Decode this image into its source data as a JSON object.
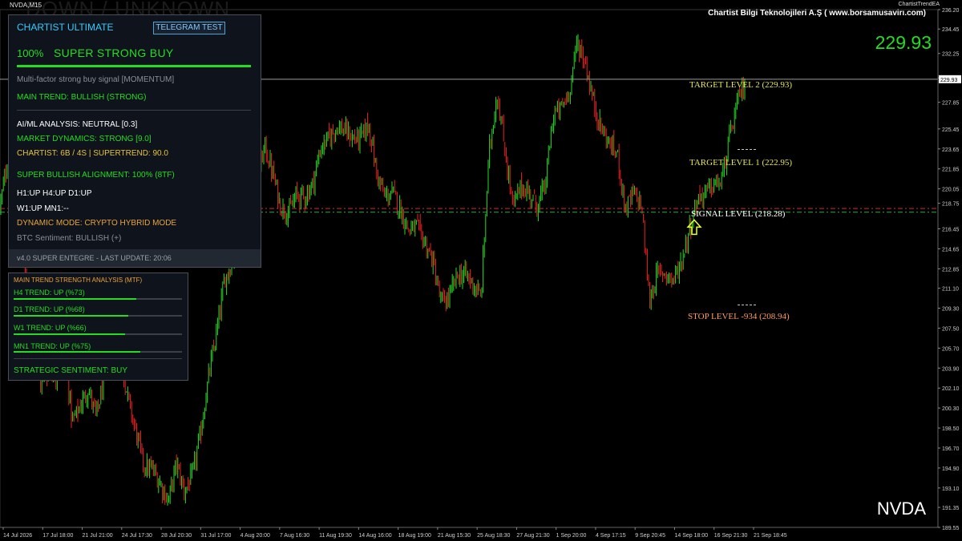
{
  "window": {
    "symbol_title": "NVDA,M15",
    "watermark": "DOWN / UNKNOWN",
    "ea_name": "ChartistTrendEA",
    "brand": "Chartist Bilgi Teknolojileri A.Ş ( www.borsamusavirı.com)",
    "big_price": "229.93",
    "symbol_big": "NVDA",
    "price_tag": "229.93"
  },
  "levels": {
    "target2": "TARGET LEVEL 2 (229.93)",
    "target1": "TARGET LEVEL 1 (222.95)",
    "signal": "SIGNAL LEVEL (218.28)",
    "stop": "STOP LEVEL -934 (208.94)"
  },
  "panel_main": {
    "title": "CHARTIST ULTIMATE",
    "telegram_button": "TELEGRAM TEST",
    "signal_pct": "100%",
    "signal_label": "SUPER STRONG BUY",
    "signal_desc": "Multi-factor strong buy signal [MOMENTUM]",
    "main_trend": "MAIN TREND: BULLISH (STRONG)",
    "ai_ml": "AI/ML ANALYSIS: NEUTRAL [0.3]",
    "market_dynamics": "MARKET DYNAMICS: STRONG [9.0]",
    "chartist": "CHARTIST: 6B / 4S | SUPERTREND: 90.0",
    "alignment": "SUPER BULLISH ALIGNMENT: 100% (8TF)",
    "tf_line1": "H1:UP H4:UP D1:UP",
    "tf_line2": "W1:UP MN1:--",
    "dynamic_mode": "DYNAMIC MODE: CRYPTO HYBRID MODE",
    "btc_sentiment": "BTC Sentiment: BULLISH (+)",
    "footer": "v4.0 SUPER ENTEGRE - LAST UPDATE: 20:06"
  },
  "panel_mtf": {
    "title": "MAIN TREND STRENGTH ANALYSIS (MTF)",
    "rows": [
      {
        "label": "H4 TREND: UP (%73)",
        "strength": 0.73
      },
      {
        "label": "D1 TREND: UP (%68)",
        "strength": 0.68
      },
      {
        "label": "W1 TREND: UP (%66)",
        "strength": 0.66
      },
      {
        "label": "MN1 TREND: UP (%75)",
        "strength": 0.75
      }
    ],
    "sentiment": "STRATEGIC SENTIMENT: BUY"
  },
  "colors": {
    "bull": "#22dd22",
    "bear": "#ee2222",
    "accent": "#33ccff",
    "target": "#e6e656",
    "stop": "#ff9a5a"
  },
  "chart_data": {
    "type": "candlestick",
    "symbol": "NVDA",
    "timeframe": "M15",
    "ylim": [
      189.55,
      236.2
    ],
    "y_ticks": [
      "236.20",
      "234.45",
      "232.25",
      "230.05",
      "229.93",
      "227.85",
      "225.45",
      "223.65",
      "221.85",
      "220.05",
      "218.75",
      "216.45",
      "214.65",
      "212.85",
      "211.10",
      "209.30",
      "207.50",
      "205.70",
      "203.90",
      "202.10",
      "200.30",
      "198.50",
      "196.70",
      "194.90",
      "193.10",
      "191.35",
      "189.55"
    ],
    "x_ticks": [
      "14 Jul 2026",
      "17 Jul 18:00",
      "21 Jul 21:00",
      "24 Jul 17:30",
      "28 Jul 20:30",
      "31 Jul 17:00",
      "4 Aug 20:00",
      "7 Aug 16:30",
      "11 Aug 19:30",
      "14 Aug 16:00",
      "18 Aug 19:00",
      "21 Aug 15:30",
      "25 Aug 18:30",
      "27 Aug 21:30",
      "1 Sep 20:00",
      "4 Sep 17:15",
      "9 Sep 20:45",
      "14 Sep 18:00",
      "16 Sep 21:30",
      "21 Sep 18:45"
    ],
    "path": [
      [
        0,
        218.5
      ],
      [
        10,
        222.8
      ],
      [
        20,
        219.8
      ],
      [
        30,
        213.5
      ],
      [
        40,
        207.2
      ],
      [
        50,
        202.5
      ],
      [
        60,
        203.5
      ],
      [
        70,
        203.3
      ],
      [
        80,
        206
      ],
      [
        90,
        199
      ],
      [
        100,
        200.5
      ],
      [
        110,
        202
      ],
      [
        120,
        199.5
      ],
      [
        130,
        203
      ],
      [
        140,
        206.4
      ],
      [
        150,
        205
      ],
      [
        160,
        201
      ],
      [
        170,
        198
      ],
      [
        180,
        195
      ],
      [
        190,
        194.8
      ],
      [
        200,
        193.5
      ],
      [
        210,
        191.9
      ],
      [
        220,
        195.3
      ],
      [
        230,
        192.8
      ],
      [
        240,
        194.2
      ],
      [
        250,
        198
      ],
      [
        260,
        203
      ],
      [
        270,
        207
      ],
      [
        280,
        211.8
      ],
      [
        290,
        213.5
      ],
      [
        300,
        218
      ],
      [
        310,
        221.5
      ],
      [
        320,
        220.5
      ],
      [
        330,
        223.9
      ],
      [
        340,
        221.5
      ],
      [
        350,
        218.5
      ],
      [
        360,
        217.9
      ],
      [
        370,
        219.5
      ],
      [
        380,
        219.3
      ],
      [
        390,
        220.5
      ],
      [
        400,
        223.7
      ],
      [
        410,
        224.6
      ],
      [
        420,
        225.7
      ],
      [
        430,
        225.3
      ],
      [
        440,
        224.6
      ],
      [
        450,
        224.6
      ],
      [
        460,
        225.9
      ],
      [
        470,
        221.4
      ],
      [
        480,
        219.3
      ],
      [
        490,
        219.7
      ],
      [
        500,
        218.1
      ],
      [
        510,
        216.3
      ],
      [
        520,
        216.6
      ],
      [
        530,
        215.2
      ],
      [
        540,
        213.5
      ],
      [
        550,
        209.8
      ],
      [
        560,
        210.2
      ],
      [
        570,
        212.2
      ],
      [
        580,
        212.4
      ],
      [
        590,
        211.5
      ],
      [
        600,
        210.2
      ],
      [
        610,
        223.3
      ],
      [
        620,
        228.7
      ],
      [
        630,
        223.5
      ],
      [
        640,
        218.4
      ],
      [
        650,
        220.3
      ],
      [
        660,
        219.7
      ],
      [
        670,
        218.5
      ],
      [
        680,
        220.3
      ],
      [
        690,
        226.7
      ],
      [
        700,
        227.3
      ],
      [
        710,
        228.8
      ],
      [
        720,
        233.3
      ],
      [
        730,
        231.5
      ],
      [
        740,
        227.9
      ],
      [
        750,
        225.5
      ],
      [
        760,
        224.1
      ],
      [
        770,
        223.2
      ],
      [
        780,
        218.2
      ],
      [
        790,
        219.6
      ],
      [
        800,
        218.7
      ],
      [
        810,
        210
      ],
      [
        820,
        212.4
      ],
      [
        830,
        212.5
      ],
      [
        840,
        211.8
      ],
      [
        850,
        213.5
      ],
      [
        860,
        216.5
      ],
      [
        870,
        219.2
      ],
      [
        880,
        219.7
      ],
      [
        890,
        220.4
      ],
      [
        900,
        220.7
      ],
      [
        910,
        224.6
      ],
      [
        920,
        227.8
      ],
      [
        930,
        229.9
      ]
    ]
  }
}
